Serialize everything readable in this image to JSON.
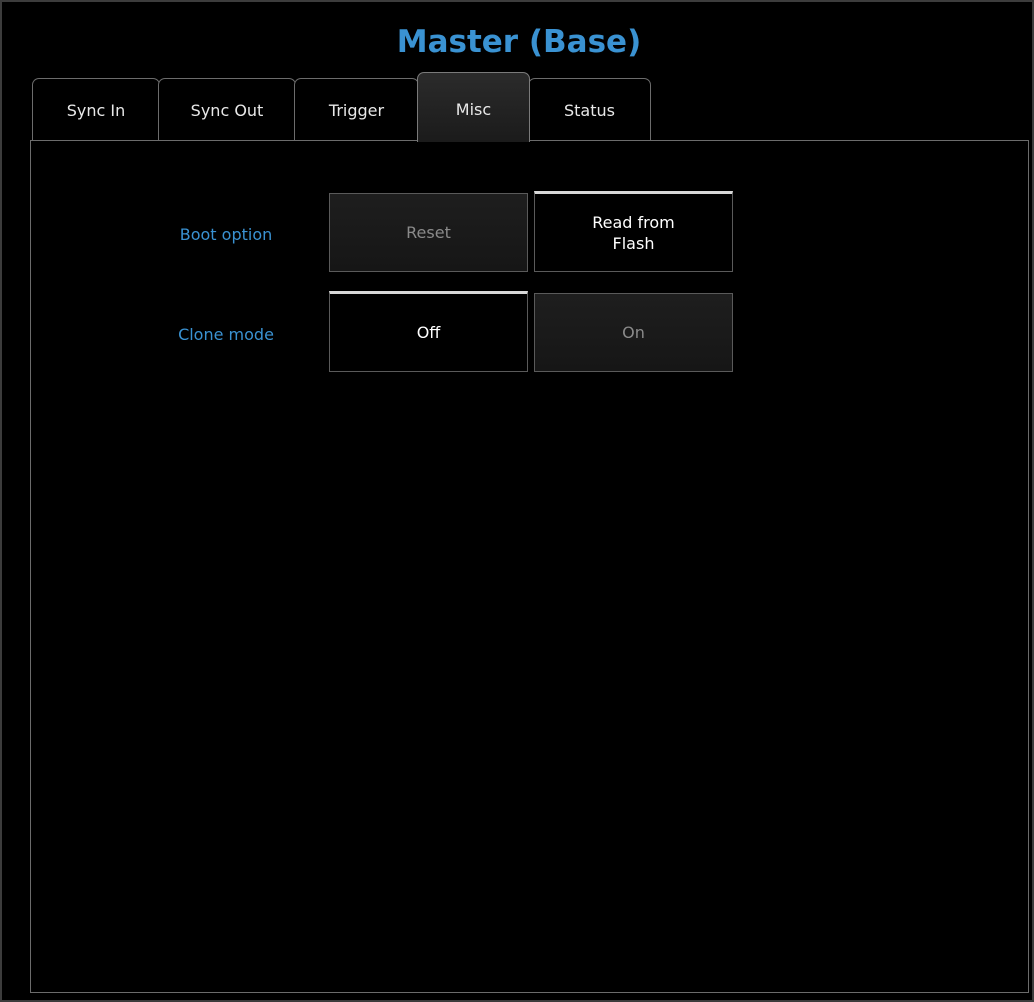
{
  "window": {
    "title": "Master (Base)"
  },
  "tabs": [
    {
      "label": "Sync In",
      "active": false
    },
    {
      "label": "Sync Out",
      "active": false
    },
    {
      "label": "Trigger",
      "active": false
    },
    {
      "label": "Misc",
      "active": true
    },
    {
      "label": "Status",
      "active": false
    }
  ],
  "misc": {
    "boot_option": {
      "label": "Boot option",
      "options": [
        {
          "label": "Reset",
          "selected": false
        },
        {
          "label_line1": "Read from",
          "label_line2": "Flash",
          "selected": true
        }
      ]
    },
    "clone_mode": {
      "label": "Clone mode",
      "options": [
        {
          "label": "Off",
          "selected": true
        },
        {
          "label": "On",
          "selected": false
        }
      ]
    }
  },
  "colors": {
    "accent": "#3a92d2",
    "background": "#000000",
    "border": "#6c6c6c",
    "selected_indicator": "#d8d8d8"
  }
}
